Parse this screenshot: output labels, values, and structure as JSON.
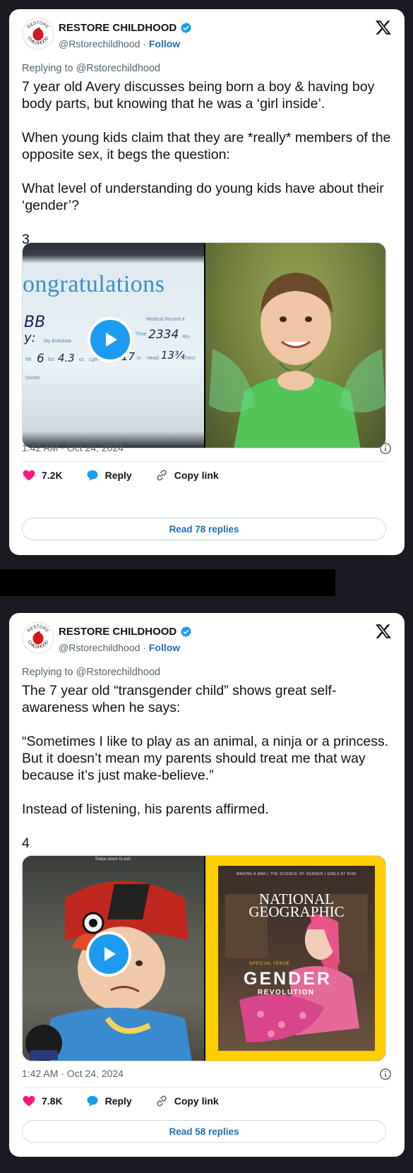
{
  "tweets": [
    {
      "account": {
        "name": "RESTORE CHILDHOOD",
        "handle": "@Rstorechildhood",
        "separator": "·",
        "follow_label": "Follow",
        "avatar_text_top": "RESTORE",
        "avatar_text_bottom": "CHILDHOOD"
      },
      "replying_to": "Replying to @Rstorechildhood",
      "text": "7 year old Avery discusses being born a boy & having boy body parts, but knowing that he was a ‘girl inside’.\n\nWhen young kids claim that they are *really* members of the opposite sex, it begs the question:\n\nWhat level of understanding do young kids have about their ‘gender’?\n\n3",
      "media": {
        "left": {
          "banner": "ongratulations",
          "line1": "BB",
          "line2": "y:",
          "birthdate_label": "My Birthdate",
          "time_label": "Time",
          "time_value": "2334",
          "record_label": "Medical Record #",
          "rm_label": "Rm",
          "wt_label": "Wt",
          "lbs_value": "6",
          "lbs_label": "lbs",
          "oz_value": "4.3",
          "oz_label": "oz",
          "len_label": "Lgth",
          "len_value": "17",
          "in_label": "in.",
          "head_label": "Head",
          "head_value": "13¾",
          "chest_label": "Chest",
          "doctor_label": "Doctor"
        },
        "right": {}
      },
      "timestamp": "1:42 AM · Oct 24, 2024",
      "likes": "7.2K",
      "reply_label": "Reply",
      "copy_label": "Copy link",
      "read_replies": "Read 78 replies"
    },
    {
      "account": {
        "name": "RESTORE CHILDHOOD",
        "handle": "@Rstorechildhood",
        "separator": "·",
        "follow_label": "Follow",
        "avatar_text_top": "RESTORE",
        "avatar_text_bottom": "CHILDHOOD"
      },
      "replying_to": "Replying to @Rstorechildhood",
      "text": "The 7 year old “transgender child” shows great self-awareness when he says:\n\n“Sometimes I like to play as an animal, a ninja or a princess. But it doesn’t mean my parents should treat me that way because it’s just make-believe.”\n\nInstead of listening, his parents affirmed.\n\n4",
      "media": {
        "left": {
          "swipe_text": "Swipe down to exit."
        },
        "right": {
          "topline": "MAKING A MAN  |  THE SCIENCE OF GENDER  |  GIRLS AT RISK",
          "masthead_1": "NATIONAL",
          "masthead_2": "GEOGRAPHIC",
          "special_issue": "SPECIAL ISSUE",
          "gender": "GENDER",
          "revolution": "REVOLUTION"
        }
      },
      "timestamp": "1:42 AM · Oct 24, 2024",
      "likes": "7.8K",
      "reply_label": "Reply",
      "copy_label": "Copy link",
      "read_replies": "Read 58 replies"
    }
  ],
  "colors": {
    "background": "#1a1a22",
    "card": "#ffffff",
    "heart": "#f91880",
    "reply_bubble": "#1d9bf0",
    "link": "#1d6fb8",
    "verified": "#1d9bf0",
    "natgeo_yellow": "#ffce00"
  },
  "icons": [
    "restore-childhood-logo",
    "verified-badge-icon",
    "x-logo-icon",
    "play-icon",
    "info-icon",
    "heart-icon",
    "reply-bubble-icon",
    "link-icon"
  ]
}
